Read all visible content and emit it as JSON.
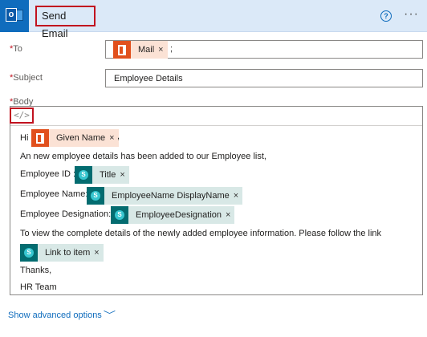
{
  "header": {
    "title": "Send Email",
    "app_icon": "outlook-icon",
    "help_icon": "help-icon",
    "more_icon": "more-options-icon"
  },
  "to": {
    "label": "To",
    "required_mark": "*",
    "token": "Mail",
    "remove": "×",
    "separator": ";"
  },
  "subject": {
    "label": "Subject",
    "required_mark": "*",
    "value": "Employee Details"
  },
  "body": {
    "label": "Body",
    "required_mark": "*",
    "code_view": "</>",
    "greeting": "Hi",
    "greeting_token": "Given Name",
    "greeting_suffix": ",",
    "line_intro": "An new employee details has been added to our Employee list,",
    "id_label": "Employee ID :",
    "id_token": "Title",
    "name_label": "Employee Name:",
    "name_token": "EmployeeName DisplayName",
    "designation_label": "Employee Designation:",
    "designation_token": "EmployeeDesignation",
    "instruction": "To view the complete details of the newly added employee information. Please follow the link",
    "link_token": "Link to item",
    "thanks": "Thanks,",
    "signature": "HR Team",
    "remove": "×",
    "sp_glyph": "S"
  },
  "advanced": {
    "label": "Show advanced options",
    "chevron": "﹀"
  },
  "colors": {
    "header_bg": "#dbe9f8",
    "accent": "#0f6cbd",
    "highlight_border": "#c1121f",
    "office_token": "#fbe2d5",
    "sharepoint_token": "#d8e8e6"
  }
}
